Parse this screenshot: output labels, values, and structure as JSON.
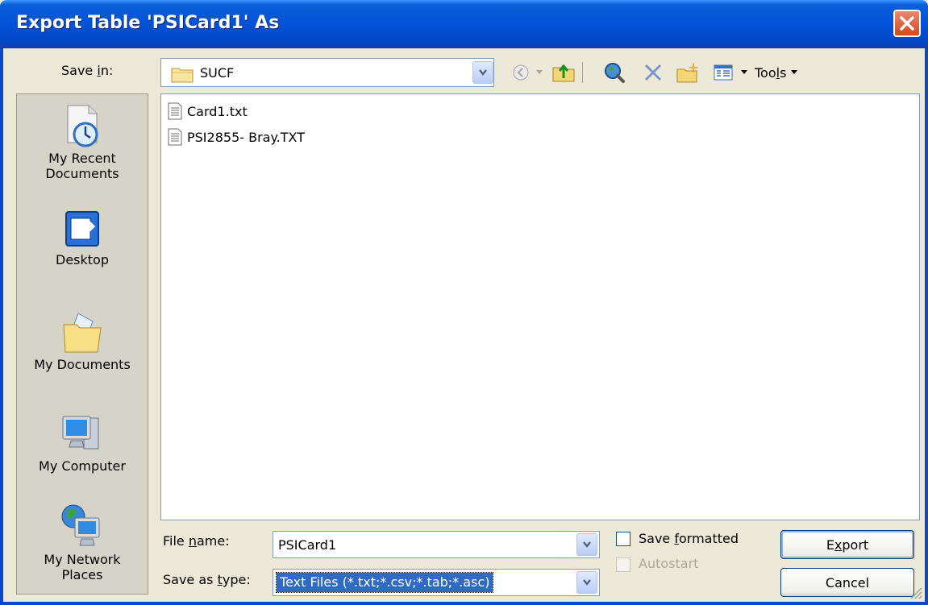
{
  "window": {
    "title": "Export Table 'PSICard1' As"
  },
  "save_in": {
    "label_pre": "Save ",
    "label_u": "i",
    "label_post": "n:",
    "value": "SUCF"
  },
  "toolbar": {
    "tools_pre": "Too",
    "tools_u": "l",
    "tools_post": "s",
    "icons": [
      "back-icon",
      "up-folder-icon",
      "search-web-icon",
      "delete-icon",
      "new-folder-icon",
      "views-icon"
    ]
  },
  "places": [
    {
      "label": "My Recent Documents",
      "line1": "My Recent",
      "line2": "Documents",
      "icon": "recent-documents-icon"
    },
    {
      "label": "Desktop",
      "line1": "Desktop",
      "line2": "",
      "icon": "desktop-icon"
    },
    {
      "label": "My Documents",
      "line1": "My Documents",
      "line2": "",
      "icon": "my-documents-icon"
    },
    {
      "label": "My Computer",
      "line1": "My Computer",
      "line2": "",
      "icon": "my-computer-icon"
    },
    {
      "label": "My Network Places",
      "line1": "My Network",
      "line2": "Places",
      "icon": "network-places-icon"
    }
  ],
  "files": [
    {
      "name": "Card1.txt",
      "icon": "text-file-icon"
    },
    {
      "name": "PSI2855- Bray.TXT",
      "icon": "text-file-icon"
    }
  ],
  "file_name": {
    "label_pre": "File ",
    "label_u": "n",
    "label_post": "ame:",
    "value": "PSICard1"
  },
  "save_as_type": {
    "label_pre": "Save as ",
    "label_u": "t",
    "label_post": "ype:",
    "value": "Text Files (*.txt;*.csv;*.tab;*.asc)"
  },
  "options": {
    "save_formatted": {
      "pre": "Save ",
      "u": "f",
      "post": "ormatted",
      "checked": false,
      "enabled": true
    },
    "autostart": {
      "label": "Autostart",
      "checked": false,
      "enabled": false
    }
  },
  "buttons": {
    "export": {
      "pre": "E",
      "u": "x",
      "post": "port"
    },
    "cancel": "Cancel"
  },
  "colors": {
    "title_bar": "#0453d9",
    "dialog_bg": "#ece9d8",
    "selection": "#316ac5"
  }
}
